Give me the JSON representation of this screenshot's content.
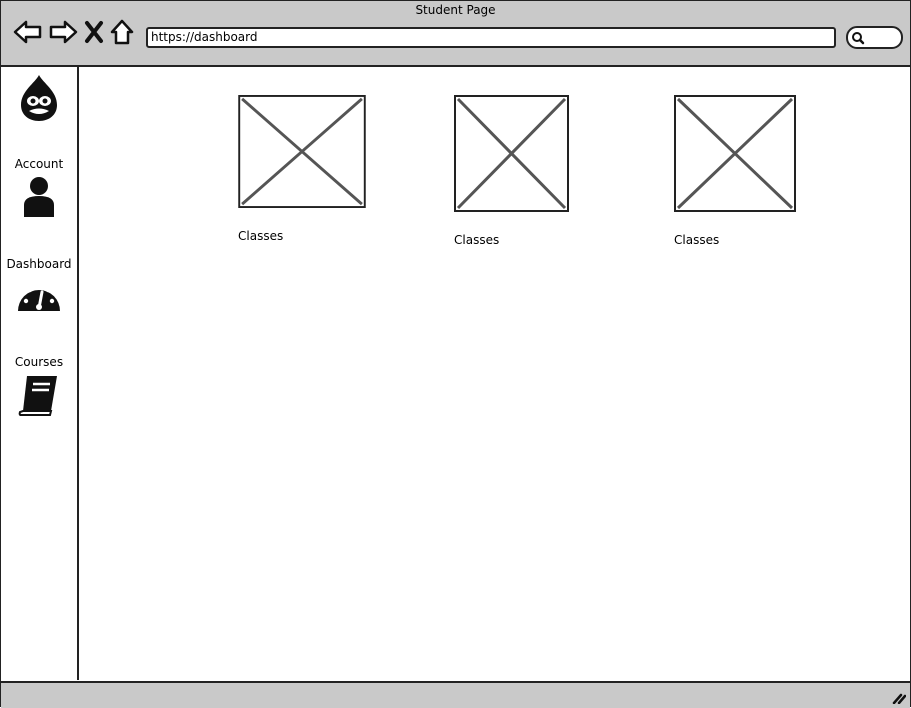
{
  "window": {
    "title": "Student Page"
  },
  "toolbar": {
    "back_icon": "back-arrow-icon",
    "forward_icon": "forward-arrow-icon",
    "stop_icon": "close-icon",
    "home_icon": "home-icon",
    "url": "https://dashboard",
    "search_icon": "search-icon"
  },
  "sidebar": {
    "logo_icon": "drupal-drop-icon",
    "items": [
      {
        "label": "Account",
        "icon": "user-icon"
      },
      {
        "label": "Dashboard",
        "icon": "gauge-icon"
      },
      {
        "label": "Courses",
        "icon": "book-icon"
      }
    ]
  },
  "main": {
    "cards": [
      {
        "label": "Classes"
      },
      {
        "label": "Classes"
      },
      {
        "label": "Classes"
      }
    ]
  },
  "colors": {
    "chrome": "#c9c9c9",
    "border": "#222222",
    "placeholder_line": "#555555"
  }
}
